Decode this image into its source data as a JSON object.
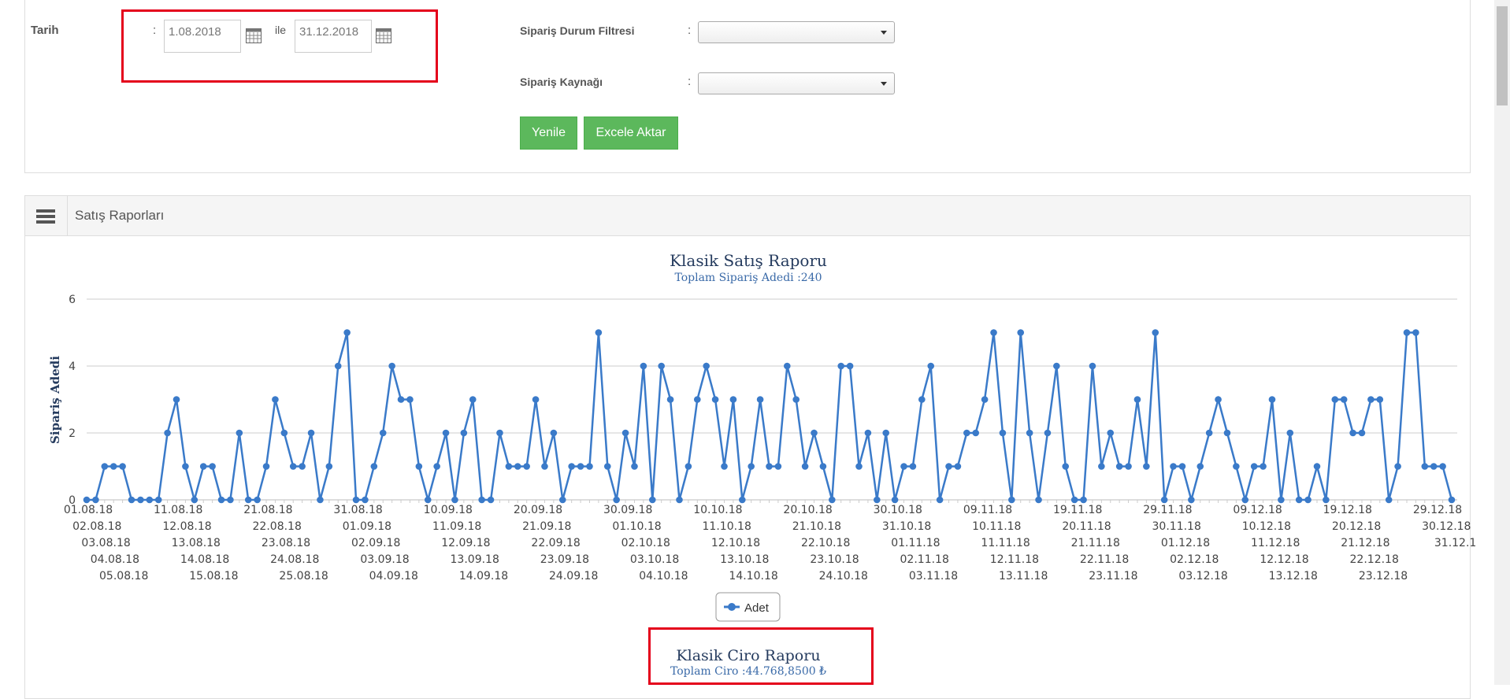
{
  "filters": {
    "tarih_label": "Tarih",
    "colon": ":",
    "date_start": "1.08.2018",
    "ile_label": "ile",
    "date_end": "31.12.2018",
    "status_filter_label": "Sipariş Durum Filtresi",
    "status_filter_value": "",
    "source_label": "Sipariş Kaynağı",
    "source_value": "",
    "refresh_button": "Yenile",
    "export_button": "Excele Aktar"
  },
  "report": {
    "header_title": "Satış Raporları",
    "ciro_title": "Klasik Ciro Raporu",
    "ciro_subtitle": "Toplam Ciro :44.768,8500 ₺"
  },
  "colors": {
    "accent_green": "#5cb85c",
    "highlight_red": "#e4001b",
    "series_blue": "#3a7ac9",
    "title_navy": "#253b5e"
  },
  "chart_data": {
    "type": "line",
    "title": "Klasik Satış Raporu",
    "subtitle": "Toplam Sipariş Adedi :240",
    "ylabel": "Sipariş Adedi",
    "xlabel": "",
    "ylim": [
      0,
      6
    ],
    "yticks": [
      0,
      2,
      4,
      6
    ],
    "grid": true,
    "legend": "bottom-center",
    "series": [
      {
        "name": "Adet",
        "values": [
          0,
          0,
          1,
          1,
          1,
          0,
          0,
          0,
          0,
          2,
          3,
          1,
          0,
          1,
          1,
          0,
          0,
          2,
          0,
          0,
          1,
          3,
          2,
          1,
          1,
          2,
          0,
          1,
          4,
          5,
          0,
          0,
          1,
          2,
          4,
          3,
          3,
          1,
          0,
          1,
          2,
          0,
          2,
          3,
          0,
          0,
          2,
          1,
          1,
          1,
          3,
          1,
          2,
          0,
          1,
          1,
          1,
          5,
          1,
          0,
          2,
          1,
          4,
          0,
          4,
          3,
          0,
          1,
          3,
          4,
          3,
          1,
          3,
          0,
          1,
          3,
          1,
          1,
          4,
          3,
          1,
          2,
          1,
          0,
          4,
          4,
          1,
          2,
          0,
          2,
          0,
          1,
          1,
          3,
          4,
          0,
          1,
          1,
          2,
          2,
          3,
          5,
          2,
          0,
          5,
          2,
          0,
          2,
          4,
          1,
          0,
          0,
          4,
          1,
          2,
          1,
          1,
          3,
          1,
          5,
          0,
          1,
          1,
          0,
          1,
          2,
          3,
          2,
          1,
          0,
          1,
          1,
          3,
          0,
          2,
          0,
          0,
          1,
          0,
          3,
          3,
          2,
          2,
          3,
          3,
          0,
          1,
          5,
          5,
          1,
          1,
          1,
          0
        ]
      }
    ],
    "x_labels_shown": [
      "01.08.18",
      "02.08.18",
      "03.08.18",
      "04.08.18",
      "05.08.18",
      "11.08.18",
      "12.08.18",
      "13.08.18",
      "14.08.18",
      "15.08.18",
      "21.08.18",
      "22.08.18",
      "23.08.18",
      "24.08.18",
      "25.08.18",
      "31.08.18",
      "01.09.18",
      "02.09.18",
      "03.09.18",
      "04.09.18",
      "10.09.18",
      "11.09.18",
      "12.09.18",
      "13.09.18",
      "14.09.18",
      "20.09.18",
      "21.09.18",
      "22.09.18",
      "23.09.18",
      "24.09.18",
      "30.09.18",
      "01.10.18",
      "02.10.18",
      "03.10.18",
      "04.10.18",
      "10.10.18",
      "11.10.18",
      "12.10.18",
      "13.10.18",
      "14.10.18",
      "20.10.18",
      "21.10.18",
      "22.10.18",
      "23.10.18",
      "24.10.18",
      "30.10.18",
      "31.10.18",
      "01.11.18",
      "02.11.18",
      "03.11.18",
      "09.11.18",
      "10.11.18",
      "11.11.18",
      "12.11.18",
      "13.11.18",
      "19.11.18",
      "20.11.18",
      "21.11.18",
      "22.11.18",
      "23.11.18",
      "29.11.18",
      "30.11.18",
      "01.12.18",
      "02.12.18",
      "03.12.18",
      "09.12.18",
      "10.12.18",
      "11.12.18",
      "12.12.18",
      "13.12.18",
      "19.12.18",
      "20.12.18",
      "21.12.18",
      "22.12.18",
      "23.12.18",
      "29.12.18",
      "30.12.18",
      "31.12.1"
    ]
  }
}
